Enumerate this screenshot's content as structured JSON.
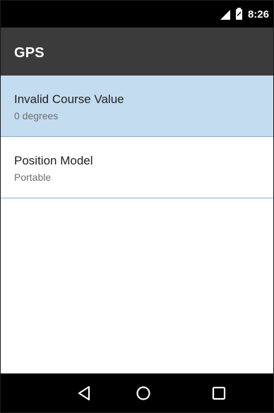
{
  "status_bar": {
    "time": "8:26",
    "icons": [
      "signal-icon",
      "battery-charging-icon"
    ]
  },
  "app_bar": {
    "title": "GPS"
  },
  "preferences": [
    {
      "title": "Invalid Course Value",
      "summary": "0 degrees",
      "selected": true
    },
    {
      "title": "Position Model",
      "summary": "Portable",
      "selected": false
    }
  ],
  "nav_bar": {
    "icons": [
      "back-icon",
      "home-icon",
      "recents-icon"
    ]
  },
  "colors": {
    "app_bar": "#3b3b3b",
    "selected_row": "#c4dcef",
    "divider": "#7fb2d9"
  }
}
